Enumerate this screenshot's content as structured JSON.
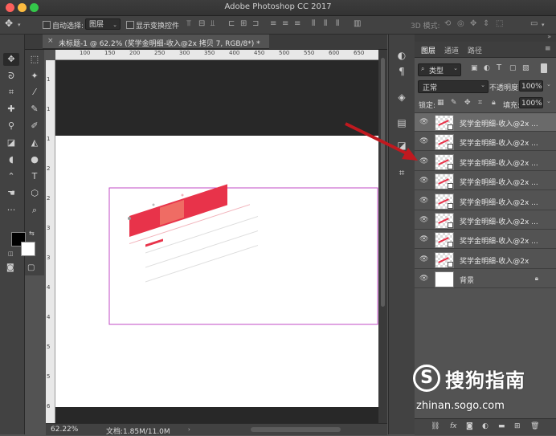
{
  "app": {
    "title": "Adobe Photoshop CC 2017"
  },
  "options": {
    "auto_select_label": "自动选择:",
    "auto_select_value": "图层",
    "show_transform_label": "显示变换控件",
    "mode_3d_label": "3D 模式:"
  },
  "document": {
    "tab_title": "未标题-1 @ 62.2% (奖学金明细-收入@2x 拷贝 7, RGB/8*) *",
    "zoom": "62.22%",
    "doc_size": "文档:1.85M/11.0M",
    "ruler_top": [
      "100",
      "150",
      "200",
      "250",
      "300",
      "350",
      "400",
      "450",
      "500",
      "550",
      "600",
      "650"
    ],
    "ruler_left": [
      "1",
      "1",
      "1",
      "2",
      "2",
      "3",
      "3",
      "4",
      "4",
      "5",
      "5",
      "6"
    ]
  },
  "panel": {
    "tabs": [
      "图层",
      "通道",
      "路径"
    ],
    "filter_label": "类型",
    "blend_mode": "正常",
    "opacity_label": "不透明度:",
    "opacity_value": "100%",
    "lock_label": "锁定:",
    "fill_label": "填充:",
    "fill_value": "100%"
  },
  "layers": [
    {
      "name": "奖学金明细-收入@2x ...",
      "selected": true
    },
    {
      "name": "奖学金明细-收入@2x ...",
      "selected": false
    },
    {
      "name": "奖学金明细-收入@2x ...",
      "selected": false
    },
    {
      "name": "奖学金明细-收入@2x ...",
      "selected": false
    },
    {
      "name": "奖学金明细-收入@2x ...",
      "selected": false
    },
    {
      "name": "奖学金明细-收入@2x ...",
      "selected": false
    },
    {
      "name": "奖学金明细-收入@2x ...",
      "selected": false
    },
    {
      "name": "奖学金明细-收入@2x",
      "selected": false
    },
    {
      "name": "背景",
      "selected": false
    }
  ],
  "watermark": {
    "brand": "搜狗指南",
    "url": "zhinan.sogo.com"
  },
  "colors": {
    "accent_red": "#e8334a",
    "arrow": "#c0191f",
    "selection": "#c04bc4"
  }
}
